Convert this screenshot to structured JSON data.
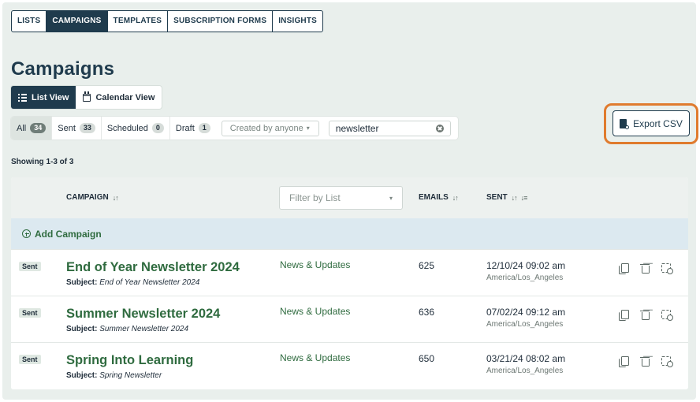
{
  "nav": {
    "tabs": [
      {
        "label": "LISTS"
      },
      {
        "label": "CAMPAIGNS"
      },
      {
        "label": "TEMPLATES"
      },
      {
        "label": "SUBSCRIPTION FORMS"
      },
      {
        "label": "INSIGHTS"
      }
    ],
    "active": "CAMPAIGNS"
  },
  "page": {
    "title": "Campaigns"
  },
  "views": {
    "list_label": "List View",
    "calendar_label": "Calendar View"
  },
  "filters": {
    "tabs": [
      {
        "label": "All",
        "count": "34"
      },
      {
        "label": "Sent",
        "count": "33"
      },
      {
        "label": "Scheduled",
        "count": "0"
      },
      {
        "label": "Draft",
        "count": "1"
      }
    ],
    "created_by": "Created by anyone",
    "search_value": "newsletter"
  },
  "export": {
    "label": "Export CSV"
  },
  "showing": "Showing 1-3 of 3",
  "table": {
    "headers": {
      "campaign": "CAMPAIGN",
      "emails": "EMAILS",
      "sent": "SENT"
    },
    "list_filter_placeholder": "Filter by List",
    "add_label": "Add Campaign",
    "subject_prefix": "Subject:",
    "rows": [
      {
        "status": "Sent",
        "name": "End of Year Newsletter 2024",
        "subject": "End of Year Newsletter 2024",
        "list": "News & Updates",
        "emails": "625",
        "sent": "12/10/24 09:02 am",
        "tz": "America/Los_Angeles"
      },
      {
        "status": "Sent",
        "name": "Summer Newsletter 2024",
        "subject": "Summer Newsletter 2024",
        "list": "News & Updates",
        "emails": "636",
        "sent": "07/02/24 09:12 am",
        "tz": "America/Los_Angeles"
      },
      {
        "status": "Sent",
        "name": "Spring Into Learning",
        "subject": "Spring Newsletter",
        "list": "News & Updates",
        "emails": "650",
        "sent": "03/21/24 08:02 am",
        "tz": "America/Los_Angeles"
      }
    ]
  },
  "colors": {
    "primary": "#1f3b4d",
    "link_green": "#2f6b3f",
    "highlight": "#e07b2e",
    "background": "#e9efec"
  }
}
